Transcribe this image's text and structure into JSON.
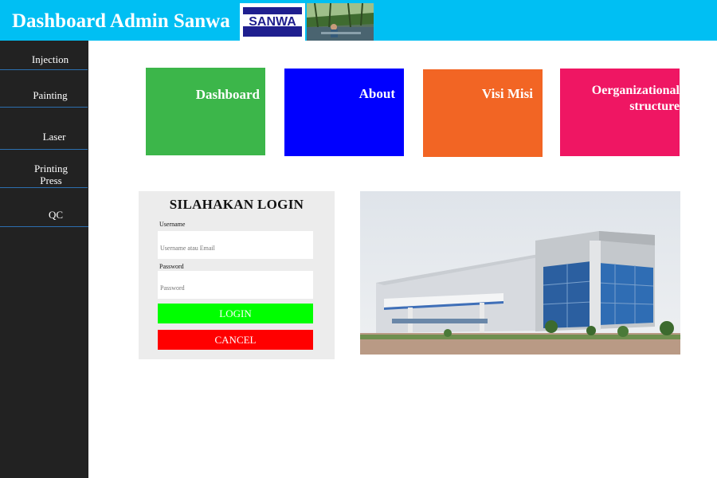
{
  "header": {
    "title": "Dashboard Admin Sanwa",
    "logo_text": "SANWA",
    "colors": {
      "bar": "#00bff3",
      "logo_blue": "#1f1f8f"
    }
  },
  "sidebar": {
    "items": [
      {
        "label": "Injection"
      },
      {
        "label": "Painting"
      },
      {
        "label": "Laser"
      },
      {
        "label": "Printing Press"
      },
      {
        "label": "QC"
      }
    ]
  },
  "tiles": [
    {
      "label": "Dashboard",
      "color": "#3cb64a"
    },
    {
      "label": "About",
      "color": "#0000ff"
    },
    {
      "label": "Visi Misi",
      "color": "#f26524"
    },
    {
      "label": "Oerganizational structure",
      "color": "#ef1663"
    }
  ],
  "login": {
    "title": "SILAHAKAN LOGIN",
    "username_label": "Username",
    "username_placeholder": "Username atau Email",
    "password_label": "Password",
    "password_placeholder": "Password",
    "login_button": "LOGIN",
    "cancel_button": "CANCEL",
    "colors": {
      "login": "#00ff00",
      "cancel": "#ff0000"
    }
  },
  "images": {
    "header_photo": "photo",
    "main_photo": "building-photo"
  }
}
